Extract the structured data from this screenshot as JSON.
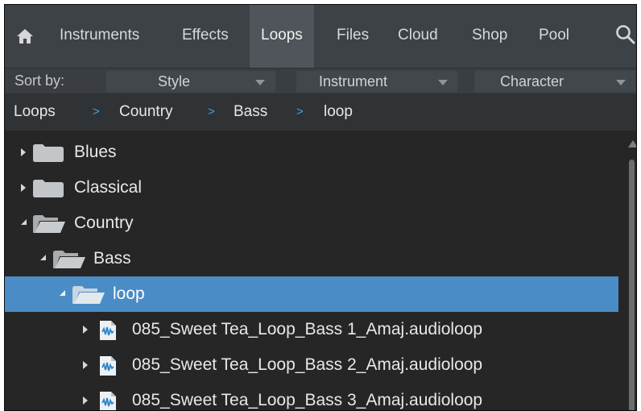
{
  "nav": {
    "home_icon": "home-icon",
    "tabs": [
      {
        "label": "Instruments",
        "active": false
      },
      {
        "label": "Effects",
        "active": false
      },
      {
        "label": "Loops",
        "active": true
      },
      {
        "label": "Files",
        "active": false
      },
      {
        "label": "Cloud",
        "active": false
      },
      {
        "label": "Shop",
        "active": false
      },
      {
        "label": "Pool",
        "active": false
      }
    ],
    "search_icon": "search-icon"
  },
  "sort": {
    "label": "Sort by:",
    "options": [
      {
        "label": "Style"
      },
      {
        "label": "Instrument"
      },
      {
        "label": "Character"
      }
    ]
  },
  "breadcrumb": {
    "items": [
      "Loops",
      "Country",
      "Bass",
      "loop"
    ],
    "separator": ">"
  },
  "tree": {
    "items": [
      {
        "label": "Blues",
        "type": "folder",
        "expanded": false,
        "depth": 0
      },
      {
        "label": "Classical",
        "type": "folder",
        "expanded": false,
        "depth": 0
      },
      {
        "label": "Country",
        "type": "folder",
        "expanded": true,
        "depth": 0
      },
      {
        "label": "Bass",
        "type": "folder",
        "expanded": true,
        "depth": 1
      },
      {
        "label": "loop",
        "type": "folder",
        "expanded": true,
        "depth": 2,
        "selected": true
      },
      {
        "label": "085_Sweet Tea_Loop_Bass 1_Amaj.audioloop",
        "type": "audioloop",
        "expanded": false,
        "depth": 3
      },
      {
        "label": "085_Sweet Tea_Loop_Bass 2_Amaj.audioloop",
        "type": "audioloop",
        "expanded": false,
        "depth": 3
      },
      {
        "label": "085_Sweet Tea_Loop_Bass 3_Amaj.audioloop",
        "type": "audioloop",
        "expanded": false,
        "depth": 3
      }
    ]
  },
  "colors": {
    "selection": "#4a8cc6",
    "breadcrumb_separator": "#4f9fd6",
    "background": "#262626",
    "tab_bar": "#3d4246"
  }
}
